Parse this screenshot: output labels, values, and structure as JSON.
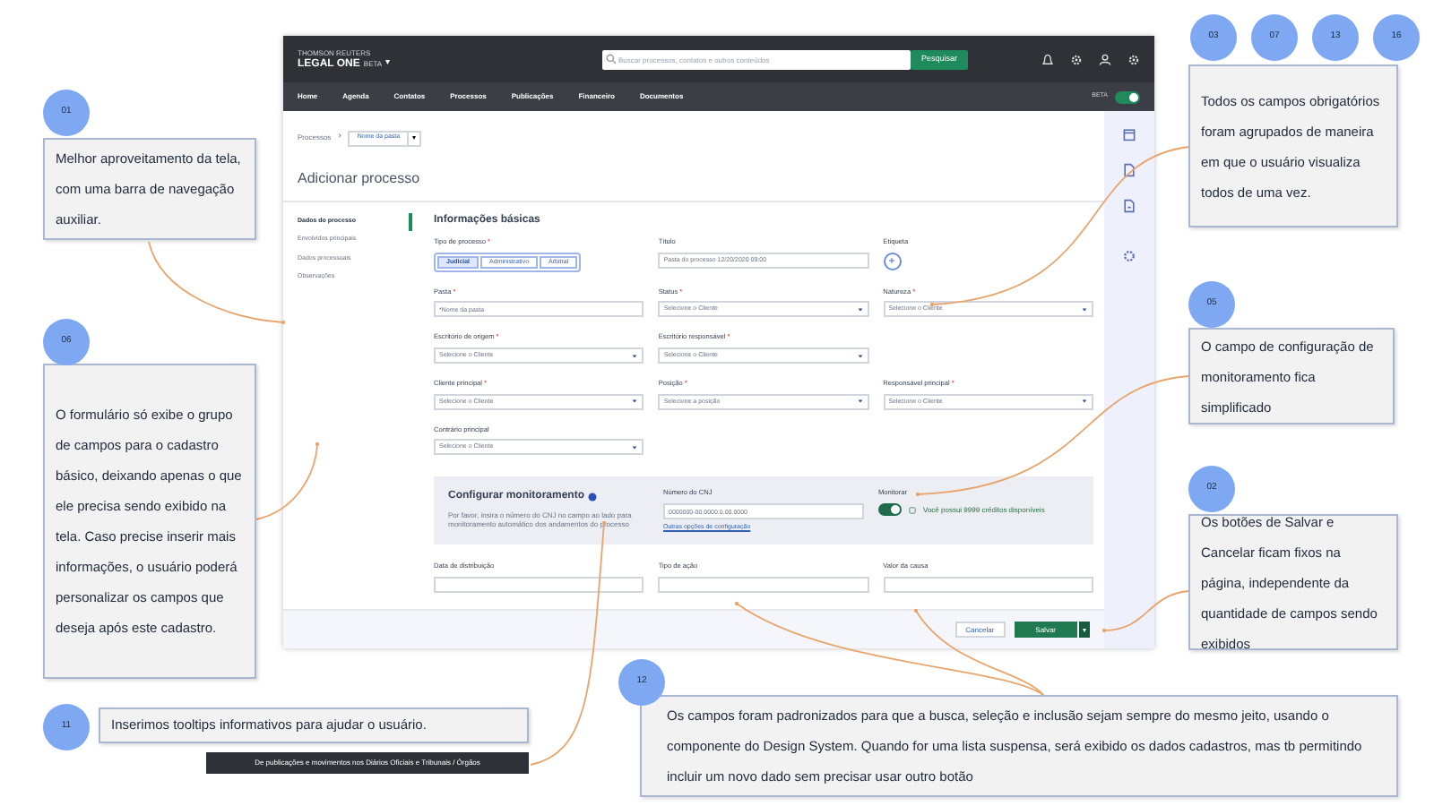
{
  "app": {
    "header": {
      "brand_small": "THOMSON REUTERS",
      "brand": "LEGAL ONE",
      "brand_badge": "BETA",
      "brand_caret": "▾",
      "search_placeholder": "Buscar processos, contatos e outros conteúdos",
      "search_button": "Pesquisar"
    },
    "nav": {
      "items": [
        "Home",
        "Agenda",
        "Contatos",
        "Processos",
        "Publicações",
        "Financeiro",
        "Documentos"
      ],
      "beta_label": "BETA",
      "beta_on": true
    },
    "breadcrumb": {
      "root": "Processos",
      "separator": "›",
      "folder": "Nome da pasta",
      "caret": "▾"
    },
    "page_title": "Adicionar processo",
    "side_nav": [
      {
        "label": "Dados do processo",
        "selected": true
      },
      {
        "label": "Envolvidos principais",
        "selected": false
      },
      {
        "label": "Dados processuais",
        "selected": false
      },
      {
        "label": "Observações",
        "selected": false
      }
    ],
    "section_title": "Informações básicas",
    "fields": [
      {
        "kind": "segmented",
        "label": "Tipo de processo",
        "required_mark": "*",
        "options": [
          {
            "label": "Judicial",
            "selected": true
          },
          {
            "label": "Administrativo",
            "selected": false
          },
          {
            "label": "Arbitral",
            "selected": false
          }
        ]
      },
      {
        "kind": "text",
        "label": "Título",
        "placeholder": "Pasta do processo 12/20/2020 09:00"
      },
      {
        "kind": "tag",
        "label": "Etiqueta"
      },
      {
        "kind": "text",
        "label": "Pasta",
        "required_mark": "*",
        "placeholder": "*Nome da pasta"
      },
      {
        "kind": "select",
        "label": "Status",
        "required_mark": "*",
        "placeholder": "Selecione o Cliente"
      },
      {
        "kind": "select",
        "label": "Natureza",
        "required_mark": "*",
        "placeholder": "Selecione o Cliente"
      },
      {
        "kind": "select",
        "label": "Escritório de origem",
        "required_mark": "*",
        "placeholder": "Selecione o Cliente"
      },
      {
        "kind": "select",
        "label": "Escritório responsável",
        "required_mark": "*",
        "placeholder": "Selecione o Cliente"
      },
      {
        "kind": "blank"
      },
      {
        "kind": "select",
        "label": "Cliente principal",
        "required_mark": "*",
        "placeholder": "Selecione o Cliente"
      },
      {
        "kind": "select",
        "label": "Posição",
        "required_mark": "*",
        "placeholder": "Selecione a posição"
      },
      {
        "kind": "select",
        "label": "Responsável principal",
        "required_mark": "*",
        "placeholder": "Selecione o Cliente"
      },
      {
        "kind": "select",
        "label": "Contrário principal",
        "placeholder": "Selecione o Cliente"
      }
    ],
    "monitor": {
      "title": "Configurar monitoramento",
      "help": "Por favor, insira o número do CNJ no campo ao lado para monitoramento automático dos andamentos do processo",
      "cnj_label": "Número do CNJ",
      "cnj_placeholder": "0000000-00.0000.0.00.0000",
      "link": "Outras opções de configuração",
      "toggle_label": "Monitorar",
      "toggle_on": true,
      "credits": "Você possui 9999 créditos disponíveis"
    },
    "last_fields": [
      "Data de distribuição",
      "Tipo de ação",
      "Valor da causa"
    ],
    "footer": {
      "cancel": "Cancelar",
      "save": "Salvar",
      "save_caret": "▾"
    }
  },
  "notes": [
    {
      "badges": [
        "03",
        "07",
        "13",
        "16"
      ],
      "text": "Todos os campos obrigatórios foram agrupados de maneira em que o usuário visualiza todos de uma vez."
    },
    {
      "badges": [
        "01"
      ],
      "text": "Melhor aproveitamento da tela, com uma barra de navegação auxiliar."
    },
    {
      "badges": [
        "05"
      ],
      "text": "O campo de configuração de monitoramento fica simplificado"
    },
    {
      "badges": [
        "06"
      ],
      "text": "O formulário só exibe o grupo de campos para o cadastro básico, deixando apenas o que ele precisa sendo exibido na tela. Caso precise inserir mais informações, o usuário poderá personalizar os campos que deseja após este cadastro."
    },
    {
      "badges": [
        "02"
      ],
      "text": "Os botões de Salvar e Cancelar ficam fixos na página, independente da quantidade de campos sendo exibidos"
    },
    {
      "badges": [
        "12"
      ],
      "text": "Os campos foram padronizados para que a busca, seleção e inclusão sejam sempre do mesmo jeito, usando o componente do Design System. Quando for uma lista suspensa, será exibido os dados cadastros, mas tb permitindo incluir um novo dado sem precisar usar outro botão"
    },
    {
      "badges": [
        "11"
      ],
      "text": "Inserimos tooltips informativos para ajudar o usuário.",
      "tooltip": "De publicações e movimentos nos Diários Oficiais e Tribunais / Órgãos"
    }
  ]
}
